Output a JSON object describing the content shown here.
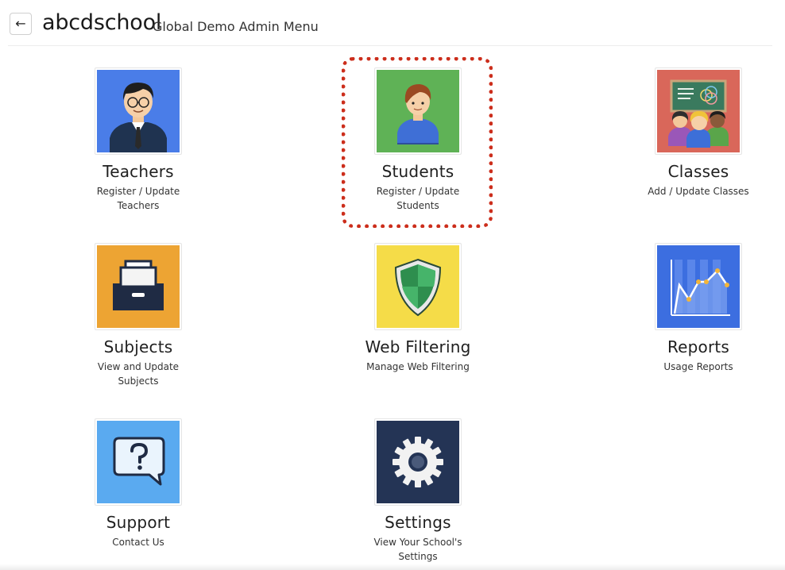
{
  "header": {
    "back_icon": "arrow-left-icon",
    "back_glyph": "←",
    "school_name": "abcdschool",
    "menu_title": "Global Demo Admin Menu"
  },
  "colors": {
    "teachers_bg": "#4a7de8",
    "students_bg": "#5fb256",
    "classes_bg": "#d9675a",
    "subjects_bg": "#eda433",
    "web_filtering_bg": "#f5dc48",
    "reports_bg": "#3c6ee0",
    "support_bg": "#5aaaf0",
    "settings_bg": "#243455",
    "highlight": "#cc2e1c"
  },
  "tiles": [
    {
      "id": "teachers",
      "icon": "teacher-icon",
      "title": "Teachers",
      "desc_line1": "Register / Update",
      "desc_line2": "Teachers"
    },
    {
      "id": "students",
      "icon": "student-icon",
      "title": "Students",
      "desc_line1": "Register / Update",
      "desc_line2": "Students"
    },
    {
      "id": "classes",
      "icon": "classroom-icon",
      "title": "Classes",
      "desc_line1": "Add / Update Classes",
      "desc_line2": ""
    },
    {
      "id": "subjects",
      "icon": "file-drawer-icon",
      "title": "Subjects",
      "desc_line1": "View and Update",
      "desc_line2": "Subjects"
    },
    {
      "id": "web_filtering",
      "icon": "shield-icon",
      "title": "Web Filtering",
      "desc_line1": "Manage Web Filtering",
      "desc_line2": ""
    },
    {
      "id": "reports",
      "icon": "line-chart-icon",
      "title": "Reports",
      "desc_line1": "Usage Reports",
      "desc_line2": ""
    },
    {
      "id": "support",
      "icon": "question-bubble-icon",
      "title": "Support",
      "desc_line1": "Contact Us",
      "desc_line2": ""
    },
    {
      "id": "settings",
      "icon": "gear-icon",
      "title": "Settings",
      "desc_line1": "View Your School's",
      "desc_line2": "Settings"
    }
  ]
}
